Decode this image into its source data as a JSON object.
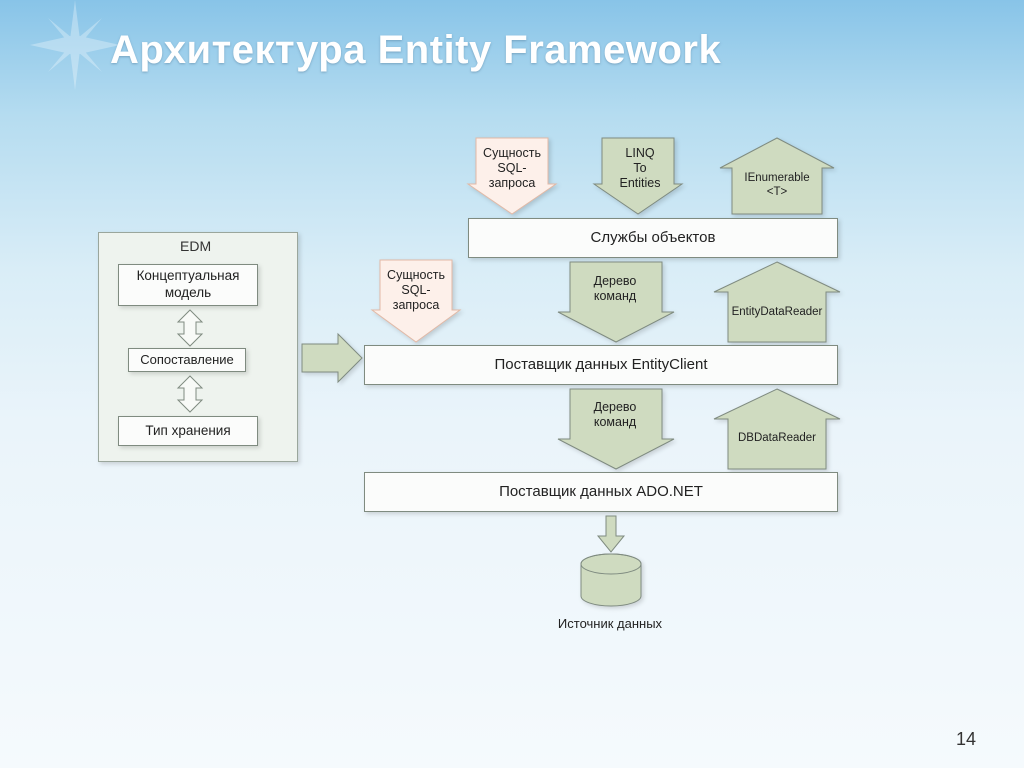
{
  "title": "Архитектура Entity Framework",
  "page_number": "14",
  "edm": {
    "title": "EDM",
    "conceptual": "Концептуальная\nмодель",
    "mapping": "Сопоставление",
    "storage": "Тип хранения"
  },
  "top_arrows": {
    "sql_query_1": "Сущность\nSQL-\nзапроса",
    "linq": "LINQ\nTo\nEntities",
    "ienumerable": "IEnumerable\n<T>"
  },
  "layers": {
    "object_services": "Службы объектов",
    "entity_client": "Поставщик данных EntityClient",
    "ado_net": "Поставщик данных ADO.NET"
  },
  "mid_arrows": {
    "sql_query_2": "Сущность\nSQL-\nзапроса",
    "command_tree_1": "Дерево\nкоманд",
    "command_tree_2": "Дерево\nкоманд",
    "entity_data_reader": "EntityDataReader",
    "db_data_reader": "DBDataReader"
  },
  "data_source": "Источник данных"
}
